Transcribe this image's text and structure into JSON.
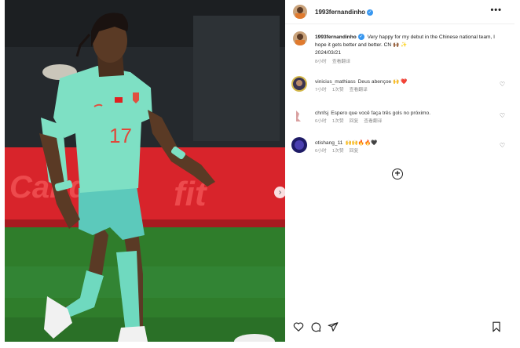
{
  "post": {
    "username": "1993fernandinho",
    "verified_icon": "verified-badge-icon",
    "more_label": "•••",
    "caption": "Very happy for my debut in the Chinese national team, I hope it gets better and better. CN 🙌🏾 ✨",
    "date": "2024/03/21",
    "caption_time": "8小时",
    "caption_translate": "查看翻译"
  },
  "photo": {
    "jersey_number": "17",
    "next_icon": "›"
  },
  "comments": [
    {
      "username": "vinicius_mathiass",
      "text": "Deus abençoe 🙌 ❤️",
      "time": "7小时",
      "likes": "1次赞",
      "translate": "查看翻译",
      "heart": "♡"
    },
    {
      "username": "chnfsj",
      "text": "Espero que você faça três gols no próximo.",
      "time": "6小时",
      "likes": "1次赞",
      "reply": "回复",
      "translate": "查看翻译",
      "heart": "♡"
    },
    {
      "username": "otishang_11",
      "text": "🙌🙌🔥🔥🖤",
      "time": "6小时",
      "likes": "1次赞",
      "reply": "回复",
      "heart": "♡"
    }
  ],
  "load_more_icon": "+",
  "actions": {
    "like_icon": "heart-icon",
    "comment_icon": "comment-icon",
    "share_icon": "share-icon",
    "save_icon": "bookmark-icon"
  },
  "colors": {
    "jersey": "#7ee0c4",
    "shorts": "#5cc9bb",
    "pitch": "#2f7d2b",
    "board": "#d8242b",
    "verified": "#3897f0"
  }
}
